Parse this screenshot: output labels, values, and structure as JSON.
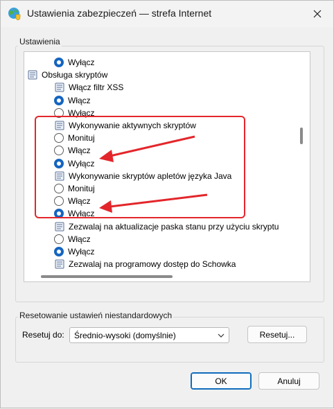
{
  "window": {
    "title": "Ustawienia zabezpieczeń — strefa Internet"
  },
  "settings_group": {
    "legend": "Ustawienia",
    "rows": [
      {
        "type": "radio",
        "label": "Wyłącz",
        "checked": true,
        "indent": 1
      },
      {
        "type": "setting",
        "label": "Obsługa skryptów",
        "indent": 0
      },
      {
        "type": "setting",
        "label": "Włącz filtr XSS",
        "indent": 1
      },
      {
        "type": "radio",
        "label": "Włącz",
        "checked": true,
        "indent": 1
      },
      {
        "type": "radio",
        "label": "Wyłącz",
        "checked": false,
        "indent": 1
      },
      {
        "type": "setting",
        "label": "Wykonywanie aktywnych skryptów",
        "indent": 1
      },
      {
        "type": "radio",
        "label": "Monituj",
        "checked": false,
        "indent": 1
      },
      {
        "type": "radio",
        "label": "Włącz",
        "checked": false,
        "indent": 1
      },
      {
        "type": "radio",
        "label": "Wyłącz",
        "checked": true,
        "indent": 1
      },
      {
        "type": "setting",
        "label": "Wykonywanie skryptów apletów języka Java",
        "indent": 1
      },
      {
        "type": "radio",
        "label": "Monituj",
        "checked": false,
        "indent": 1
      },
      {
        "type": "radio",
        "label": "Włącz",
        "checked": false,
        "indent": 1
      },
      {
        "type": "radio",
        "label": "Wyłącz",
        "checked": true,
        "indent": 1
      },
      {
        "type": "setting",
        "label": "Zezwalaj na aktualizacje paska stanu przy użyciu skryptu",
        "indent": 1
      },
      {
        "type": "radio",
        "label": "Włącz",
        "checked": false,
        "indent": 1
      },
      {
        "type": "radio",
        "label": "Wyłącz",
        "checked": true,
        "indent": 1
      },
      {
        "type": "setting",
        "label": "Zezwalaj na programowy dostęp do Schowka",
        "indent": 1
      }
    ]
  },
  "reset_group": {
    "legend": "Resetowanie ustawień niestandardowych",
    "reset_to_label": "Resetuj do:",
    "selected_level": "Średnio-wysoki (domyślnie)",
    "reset_button": "Resetuj..."
  },
  "footer": {
    "ok": "OK",
    "cancel": "Anuluj"
  },
  "colors": {
    "accent": "#1565c0",
    "annotation": "#e3262b"
  }
}
